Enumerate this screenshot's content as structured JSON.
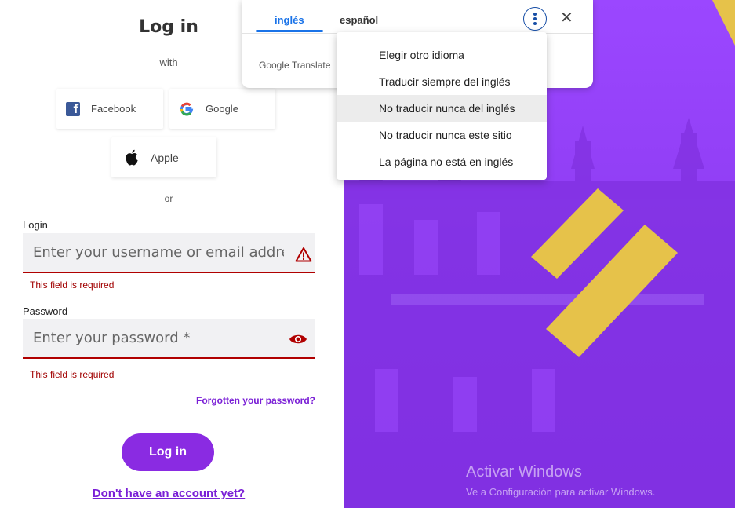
{
  "login": {
    "title": "Log in",
    "with_text": "with",
    "social": {
      "facebook": "Facebook",
      "google": "Google",
      "apple": "Apple"
    },
    "or_text": "or",
    "login_label": "Login",
    "login_placeholder": "Enter your username or email address *",
    "login_error": "This field is required",
    "password_label": "Password",
    "password_placeholder": "Enter your password *",
    "password_error": "This field is required",
    "forgot": "Forgotten your password?",
    "submit": "Log in",
    "signup": "Don't have an account yet?"
  },
  "translate_bar": {
    "tab_source": "inglés",
    "tab_target": "español",
    "brand": "Google Translate",
    "menu_items": [
      "Elegir otro idioma",
      "Traducir siempre del inglés",
      "No traducir nunca del inglés",
      "No traducir nunca este sitio",
      "La página no está en inglés"
    ],
    "highlighted_index": 2
  },
  "watermark": {
    "line1": "Activar Windows",
    "line2": "Ve a Configuración para activar Windows."
  },
  "colors": {
    "accent": "#8a2be2",
    "error": "#a10000",
    "hero_purple": "#9b47ff",
    "stripe_yellow": "#e6c24a",
    "translate_blue": "#1a73e8"
  }
}
